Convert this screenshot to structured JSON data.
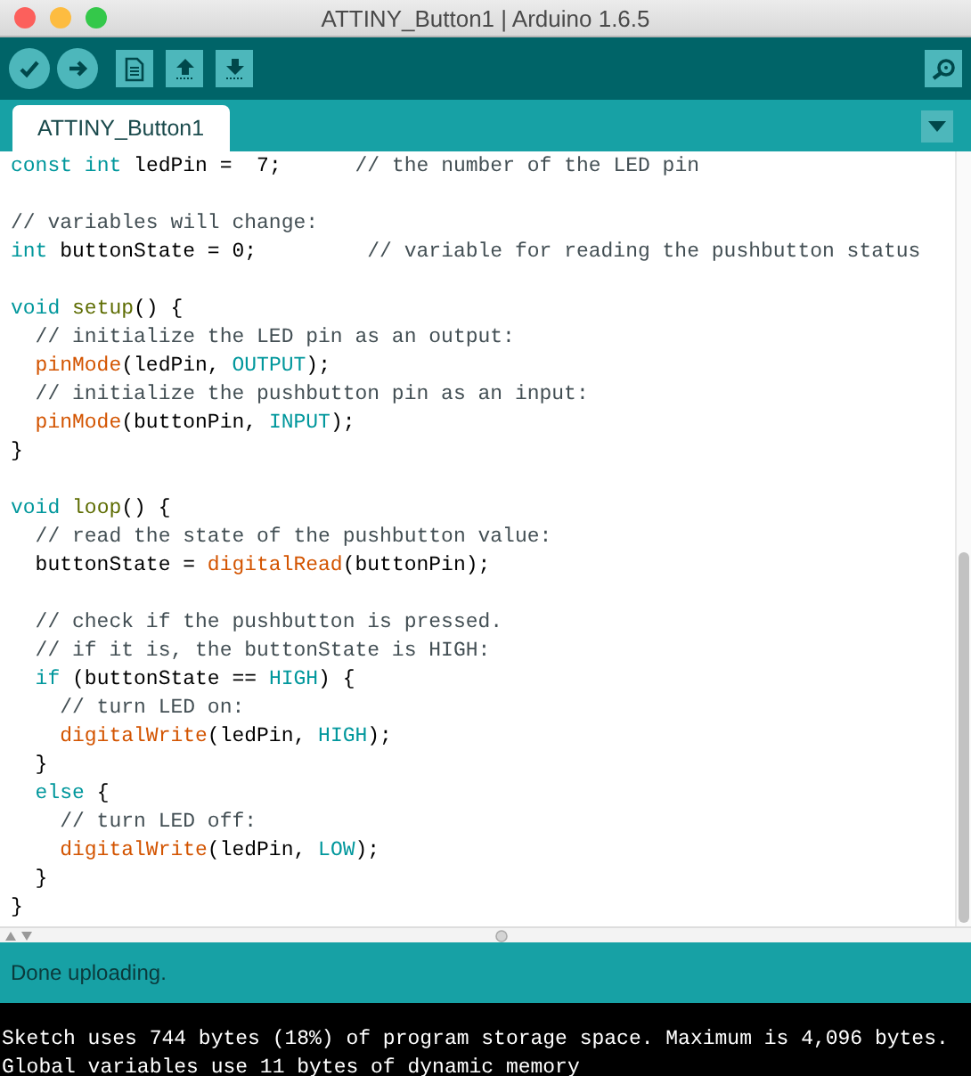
{
  "window": {
    "title": "ATTINY_Button1 | Arduino 1.6.5"
  },
  "tabs": [
    {
      "label": "ATTINY_Button1",
      "selected": true
    }
  ],
  "editor": {
    "lines": [
      {
        "kind": "code",
        "tokens": [
          {
            "kind": "keyword",
            "text": "const "
          },
          {
            "kind": "keyword",
            "text": "int"
          },
          {
            "kind": "plain",
            "text": " ledPin =  7;      "
          },
          {
            "kind": "comment",
            "text": "// the number of the LED pin"
          }
        ]
      },
      {
        "kind": "blank"
      },
      {
        "kind": "code",
        "tokens": [
          {
            "kind": "comment",
            "text": "// variables will change:"
          }
        ]
      },
      {
        "kind": "code",
        "tokens": [
          {
            "kind": "keyword",
            "text": "int"
          },
          {
            "kind": "plain",
            "text": " buttonState = 0;         "
          },
          {
            "kind": "comment",
            "text": "// variable for reading the pushbutton status"
          }
        ]
      },
      {
        "kind": "blank"
      },
      {
        "kind": "code",
        "tokens": [
          {
            "kind": "keyword",
            "text": "void "
          },
          {
            "kind": "entry",
            "text": "setup"
          },
          {
            "kind": "plain",
            "text": "() {"
          }
        ]
      },
      {
        "kind": "code",
        "tokens": [
          {
            "kind": "comment",
            "text": "  // initialize the LED pin as an output:"
          }
        ]
      },
      {
        "kind": "code",
        "tokens": [
          {
            "kind": "function",
            "text": "  pinMode"
          },
          {
            "kind": "plain",
            "text": "(ledPin, "
          },
          {
            "kind": "keyword",
            "text": "OUTPUT"
          },
          {
            "kind": "plain",
            "text": ");"
          }
        ]
      },
      {
        "kind": "code",
        "tokens": [
          {
            "kind": "comment",
            "text": "  // initialize the pushbutton pin as an input:"
          }
        ]
      },
      {
        "kind": "code",
        "tokens": [
          {
            "kind": "function",
            "text": "  pinMode"
          },
          {
            "kind": "plain",
            "text": "(buttonPin, "
          },
          {
            "kind": "keyword",
            "text": "INPUT"
          },
          {
            "kind": "plain",
            "text": ");"
          }
        ]
      },
      {
        "kind": "code",
        "tokens": [
          {
            "kind": "plain",
            "text": "}"
          }
        ]
      },
      {
        "kind": "blank"
      },
      {
        "kind": "code",
        "tokens": [
          {
            "kind": "keyword",
            "text": "void "
          },
          {
            "kind": "entry",
            "text": "loop"
          },
          {
            "kind": "plain",
            "text": "() {"
          }
        ]
      },
      {
        "kind": "code",
        "tokens": [
          {
            "kind": "comment",
            "text": "  // read the state of the pushbutton value:"
          }
        ]
      },
      {
        "kind": "code",
        "tokens": [
          {
            "kind": "plain",
            "text": "  buttonState = "
          },
          {
            "kind": "function",
            "text": "digitalRead"
          },
          {
            "kind": "plain",
            "text": "(buttonPin);"
          }
        ]
      },
      {
        "kind": "blank"
      },
      {
        "kind": "code",
        "tokens": [
          {
            "kind": "comment",
            "text": "  // check if the pushbutton is pressed."
          }
        ]
      },
      {
        "kind": "code",
        "tokens": [
          {
            "kind": "comment",
            "text": "  // if it is, the buttonState is HIGH:"
          }
        ]
      },
      {
        "kind": "code",
        "tokens": [
          {
            "kind": "keyword",
            "text": "  if"
          },
          {
            "kind": "plain",
            "text": " (buttonState == "
          },
          {
            "kind": "keyword",
            "text": "HIGH"
          },
          {
            "kind": "plain",
            "text": ") {"
          }
        ]
      },
      {
        "kind": "code",
        "tokens": [
          {
            "kind": "comment",
            "text": "    // turn LED on:"
          }
        ]
      },
      {
        "kind": "code",
        "tokens": [
          {
            "kind": "function",
            "text": "    digitalWrite"
          },
          {
            "kind": "plain",
            "text": "(ledPin, "
          },
          {
            "kind": "keyword",
            "text": "HIGH"
          },
          {
            "kind": "plain",
            "text": ");"
          }
        ]
      },
      {
        "kind": "code",
        "tokens": [
          {
            "kind": "plain",
            "text": "  }"
          }
        ]
      },
      {
        "kind": "code",
        "tokens": [
          {
            "kind": "keyword",
            "text": "  else"
          },
          {
            "kind": "plain",
            "text": " {"
          }
        ]
      },
      {
        "kind": "code",
        "tokens": [
          {
            "kind": "comment",
            "text": "    // turn LED off:"
          }
        ]
      },
      {
        "kind": "code",
        "tokens": [
          {
            "kind": "function",
            "text": "    digitalWrite"
          },
          {
            "kind": "plain",
            "text": "(ledPin, "
          },
          {
            "kind": "keyword",
            "text": "LOW"
          },
          {
            "kind": "plain",
            "text": ");"
          }
        ]
      },
      {
        "kind": "code",
        "tokens": [
          {
            "kind": "plain",
            "text": "  }"
          }
        ]
      },
      {
        "kind": "code",
        "tokens": [
          {
            "kind": "plain",
            "text": "}"
          }
        ]
      }
    ]
  },
  "status_bar": {
    "message": "Done uploading."
  },
  "console": {
    "lines": [
      "Sketch uses 744 bytes (18%) of program storage space. Maximum is 4,096 bytes.",
      "Global variables use 11 bytes of dynamic memory"
    ]
  }
}
